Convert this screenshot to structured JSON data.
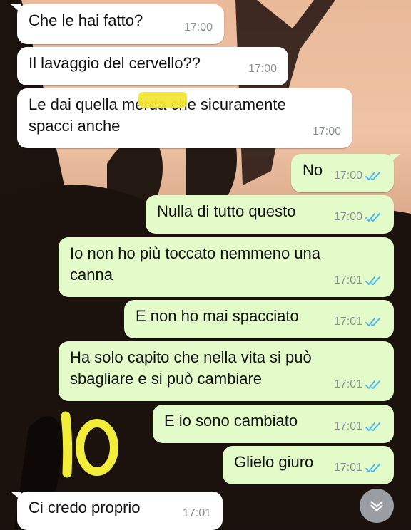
{
  "messages": [
    {
      "text": "Che le hai fatto?",
      "time": "17:00",
      "dir": "in"
    },
    {
      "text": "Il lavaggio del cervello??",
      "time": "17:00",
      "dir": "in"
    },
    {
      "text": "Le dai quella merda che sicuramente spacci anche",
      "time": "17:00",
      "dir": "in"
    },
    {
      "text": "No",
      "time": "17:00",
      "dir": "out"
    },
    {
      "text": "Nulla di tutto questo",
      "time": "17:00",
      "dir": "out"
    },
    {
      "text": "Io non ho più toccato nemmeno una canna",
      "time": "17:01",
      "dir": "out"
    },
    {
      "text": "E non ho mai spacciato",
      "time": "17:01",
      "dir": "out"
    },
    {
      "text": "Ha solo capito che nella vita si può sbagliare e si può cambiare",
      "time": "17:01",
      "dir": "out"
    },
    {
      "text": "E io sono cambiato",
      "time": "17:01",
      "dir": "out"
    },
    {
      "text": "Glielo giuro",
      "time": "17:01",
      "dir": "out"
    },
    {
      "text": "Ci credo proprio",
      "time": "17:01",
      "dir": "in"
    }
  ],
  "annotation": {
    "text": "10",
    "color": "#f2ec3a"
  },
  "colors": {
    "incoming": "#ffffff",
    "outgoing": "#e2fbc9",
    "read_ticks": "#4fb6ec",
    "time": "#8b9096"
  },
  "icons": {
    "read_receipt": "double-check-icon",
    "scroll": "chevron-down-icon"
  }
}
